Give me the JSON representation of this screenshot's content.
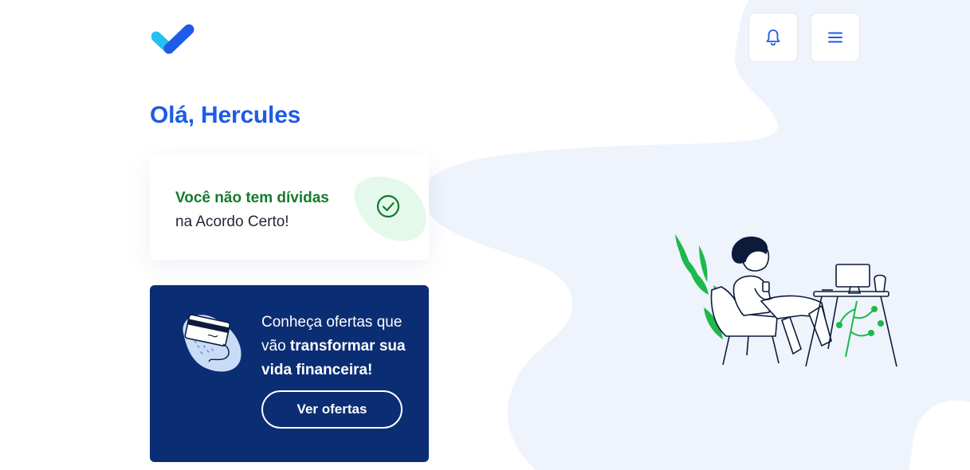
{
  "header": {
    "logo_icon": "check-logo-icon",
    "notifications_icon": "bell-icon",
    "menu_icon": "hamburger-menu-icon"
  },
  "greeting": "Olá, Hercules",
  "status_card": {
    "title": "Você não tem dívidas",
    "subtitle": "na Acordo Certo!",
    "icon": "check-circle-icon"
  },
  "offer_card": {
    "text_line1": "Conheça ofertas que",
    "text_prefix": "vão ",
    "text_bold": "transformar sua vida financeira!",
    "button_label": "Ver ofertas",
    "icon": "credit-card-illustration"
  },
  "colors": {
    "brand_blue": "#1e5be6",
    "navy": "#0b2d73",
    "success_green": "#157a2c",
    "background_blob": "#eef3fc"
  }
}
